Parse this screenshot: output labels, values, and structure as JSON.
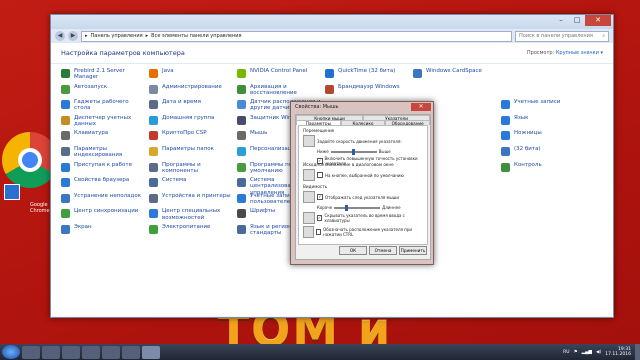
{
  "window": {
    "address": [
      "Панель управления",
      "Все элементы панели управления"
    ],
    "search_placeholder": "Поиск в панели управления",
    "heading": "Настройка параметров компьютера",
    "view_label": "Просмотр:",
    "view_value": "Крупные значки ▾"
  },
  "items": [
    {
      "label": "Firebird 2.1 Server Manager",
      "color": "#2c7a3a"
    },
    {
      "label": "Java",
      "color": "#e76f00"
    },
    {
      "label": "NVIDIA Control Panel",
      "color": "#76b900"
    },
    {
      "label": "QuickTime (32 бита)",
      "color": "#1f6fd6"
    },
    {
      "label": "Windows CardSpace",
      "color": "#3a76c2"
    },
    {
      "label": "",
      "color": "#ffffff"
    },
    {
      "label": "Автозапуск",
      "color": "#4a9a3f"
    },
    {
      "label": "Администрирование",
      "color": "#7a8aa0"
    },
    {
      "label": "Архивация и восстановление",
      "color": "#3f8f3b"
    },
    {
      "label": "Брандмауэр Windows",
      "color": "#b5472f"
    },
    {
      "label": "",
      "color": "#ffffff"
    },
    {
      "label": "",
      "color": "#ffffff"
    },
    {
      "label": "Гаджеты рабочего стола",
      "color": "#2a7bd8"
    },
    {
      "label": "Дата и время",
      "color": "#5b6c88"
    },
    {
      "label": "Датчик расположения и другие датчики",
      "color": "#4b8bd6"
    },
    {
      "label": "",
      "color": "#ffffff"
    },
    {
      "label": "",
      "color": "#ffffff"
    },
    {
      "label": "Учетные записи",
      "color": "#2a7bd8"
    },
    {
      "label": "Диспетчер учетных данных",
      "color": "#c28f1f"
    },
    {
      "label": "Домашняя группа",
      "color": "#2a9ad8"
    },
    {
      "label": "Защитник Windows",
      "color": "#4a4a6a"
    },
    {
      "label": "",
      "color": "#ffffff"
    },
    {
      "label": "",
      "color": "#ffffff"
    },
    {
      "label": "Язык",
      "color": "#2a7bd8"
    },
    {
      "label": "Клавиатура",
      "color": "#6a6a6a"
    },
    {
      "label": "КриптоПро CSP",
      "color": "#c23a2a"
    },
    {
      "label": "Мышь",
      "color": "#6a6a6a"
    },
    {
      "label": "",
      "color": "#ffffff"
    },
    {
      "label": "",
      "color": "#ffffff"
    },
    {
      "label": "Ножницы",
      "color": "#2a7bd8"
    },
    {
      "label": "Параметры индексирования",
      "color": "#5b6c88"
    },
    {
      "label": "Параметры папок",
      "color": "#d8a82a"
    },
    {
      "label": "Персонализация",
      "color": "#2aa0d8"
    },
    {
      "label": "",
      "color": "#ffffff"
    },
    {
      "label": "",
      "color": "#ffffff"
    },
    {
      "label": "(32 бита)",
      "color": "#3a76c2"
    },
    {
      "label": "Приступая к работе",
      "color": "#2a7bd8"
    },
    {
      "label": "Программы и компоненты",
      "color": "#5b6c88"
    },
    {
      "label": "Программы по умолчанию",
      "color": "#4a9a3f"
    },
    {
      "label": "",
      "color": "#ffffff"
    },
    {
      "label": "",
      "color": "#ffffff"
    },
    {
      "label": "Контроль",
      "color": "#3f8f3b"
    },
    {
      "label": "Свойства браузера",
      "color": "#2a7bd8"
    },
    {
      "label": "Система",
      "color": "#4a6a9a"
    },
    {
      "label": "Система централизованного управления",
      "color": "#4a6a9a"
    },
    {
      "label": "",
      "color": "#ffffff"
    },
    {
      "label": "",
      "color": "#ffffff"
    },
    {
      "label": "",
      "color": "#ffffff"
    },
    {
      "label": "Устранение неполадок",
      "color": "#3a76c2"
    },
    {
      "label": "Устройства и принтеры",
      "color": "#5b6c88"
    },
    {
      "label": "Учетные записи пользователей",
      "color": "#2a7bd8"
    },
    {
      "label": "",
      "color": "#ffffff"
    },
    {
      "label": "",
      "color": "#ffffff"
    },
    {
      "label": "",
      "color": "#ffffff"
    },
    {
      "label": "Центр синхронизации",
      "color": "#3f9f3b"
    },
    {
      "label": "Центр специальных возможностей",
      "color": "#2a7bd8"
    },
    {
      "label": "Шрифты",
      "color": "#4a4a4a"
    },
    {
      "label": "",
      "color": "#ffffff"
    },
    {
      "label": "",
      "color": "#ffffff"
    },
    {
      "label": "",
      "color": "#ffffff"
    },
    {
      "label": "Экран",
      "color": "#3a76c2"
    },
    {
      "label": "Электропитание",
      "color": "#3f9f3b"
    },
    {
      "label": "Язык и региональные стандарты",
      "color": "#4a6a9a"
    },
    {
      "label": "",
      "color": "#ffffff"
    },
    {
      "label": "",
      "color": "#ffffff"
    },
    {
      "label": "",
      "color": "#ffffff"
    }
  ],
  "dialog": {
    "title": "Свойства: Мышь",
    "tabs": [
      "Кнопки мыши",
      "Указатели",
      "Колесико",
      "Оборудование",
      "Параметры указателя"
    ],
    "movement_title": "Перемещение",
    "speed_label": "Задайте скорость движения указателя:",
    "slow": "Ниже",
    "fast": "Выше",
    "speed_level": 0.5,
    "precision": "Включить повышенную точность установки указателя",
    "snap_title": "Исходное положение в диалоговом окне",
    "snap": "На кнопке, выбранной по умолчанию",
    "visibility_title": "Видимость",
    "trails": "Отображать след указателя мыши",
    "trails_short": "Короче",
    "trails_long": "Длиннее",
    "trails_level": 0.25,
    "hide": "Скрывать указатель во время ввода с клавиатуры",
    "ctrl": "Обозначать расположение указателя при нажатии CTRL",
    "ok": "ОК",
    "cancel": "Отмена",
    "apply": "Применить"
  },
  "desktop": {
    "chrome_label": "Google Chrome",
    "banner": "ТОМ и ДЖЕРИ"
  },
  "taskbar": {
    "lang": "RU",
    "time": "19:31",
    "date": "17.11.2016"
  }
}
